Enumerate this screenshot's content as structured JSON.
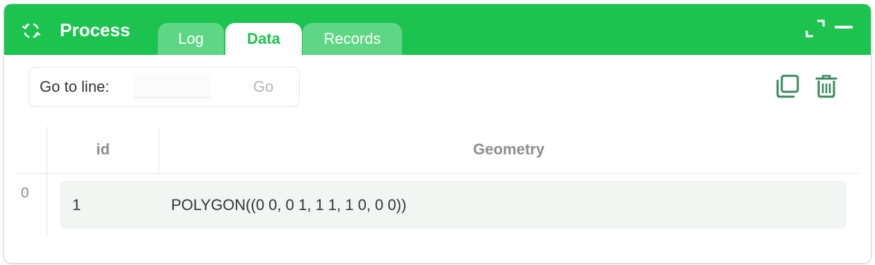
{
  "header": {
    "title": "Process",
    "tabs": [
      {
        "label": "Log",
        "active": false
      },
      {
        "label": "Data",
        "active": true
      },
      {
        "label": "Records",
        "active": false
      }
    ],
    "icons": {
      "process": "process-refresh-icon",
      "expand": "expand-icon",
      "minimize": "minimize-icon"
    }
  },
  "toolbar": {
    "goto_label": "Go to line:",
    "goto_value": "",
    "goto_button": "Go",
    "actions": [
      {
        "name": "copy",
        "icon": "copy-icon"
      },
      {
        "name": "delete",
        "icon": "trash-icon"
      }
    ]
  },
  "table": {
    "columns": [
      "id",
      "Geometry"
    ],
    "rows": [
      {
        "index": "0",
        "id": "1",
        "geometry": "POLYGON((0 0, 0 1, 1 1, 1 0, 0 0))"
      }
    ]
  },
  "colors": {
    "accent": "#1cc44f",
    "tab_inactive": "#5fd685",
    "icon_green": "#3a8a5c",
    "row_bg": "#f2f6f3",
    "header_text": "#8a8f8c"
  }
}
